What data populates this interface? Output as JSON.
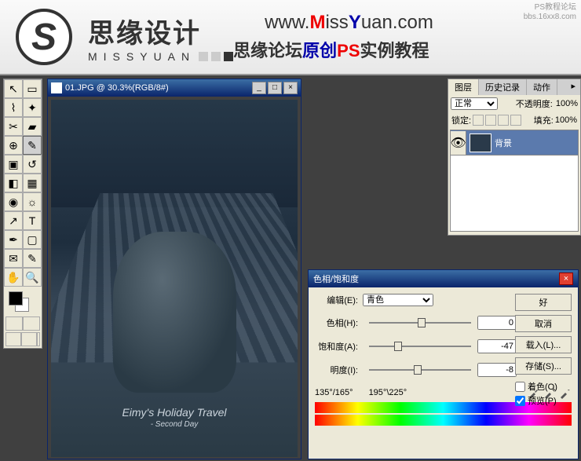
{
  "header": {
    "brand_cn": "思缘设计",
    "brand_en": "MISSYUAN",
    "url_www": "www.",
    "url_m": "M",
    "url_iss": "iss",
    "url_y": "Y",
    "url_uan": "uan.com",
    "tag1": "思缘论坛",
    "tag2": "原创",
    "tag3": "PS",
    "tag4": "实例教程",
    "wm1": "PS教程论坛",
    "wm2": "bbs.16xx8.com"
  },
  "doc": {
    "title": "01.JPG @ 30.3%(RGB/8#)",
    "photo_title": "Eimy's Holiday Travel",
    "photo_sub": "- Second Day"
  },
  "layers": {
    "tabs": [
      "图层",
      "历史记录",
      "动作"
    ],
    "mode": "正常",
    "opacity_lbl": "不透明度:",
    "opacity": "100%",
    "lock_lbl": "锁定:",
    "fill_lbl": "填充:",
    "fill": "100%",
    "items": [
      {
        "name": "背景"
      }
    ]
  },
  "dialog": {
    "title": "色相/饱和度",
    "edit_lbl": "编辑(E):",
    "edit_val": "青色",
    "hue_lbl": "色相(H):",
    "hue": "0",
    "sat_lbl": "饱和度(A):",
    "sat": "-47",
    "light_lbl": "明度(I):",
    "light": "-8",
    "range1": "135°/165°",
    "range2": "195°\\225°",
    "ok": "好",
    "cancel": "取消",
    "load": "载入(L)...",
    "save": "存储(S)...",
    "colorize": "着色(O)",
    "preview": "预览(P)"
  },
  "chart_data": {
    "type": "table",
    "title": "色相/饱和度 (Hue/Saturation adjustment values)",
    "rows": [
      {
        "param": "编辑",
        "value": "青色"
      },
      {
        "param": "色相",
        "value": 0
      },
      {
        "param": "饱和度",
        "value": -47
      },
      {
        "param": "明度",
        "value": -8
      },
      {
        "param": "范围",
        "value": "135°/165° – 195°/225°"
      }
    ]
  }
}
